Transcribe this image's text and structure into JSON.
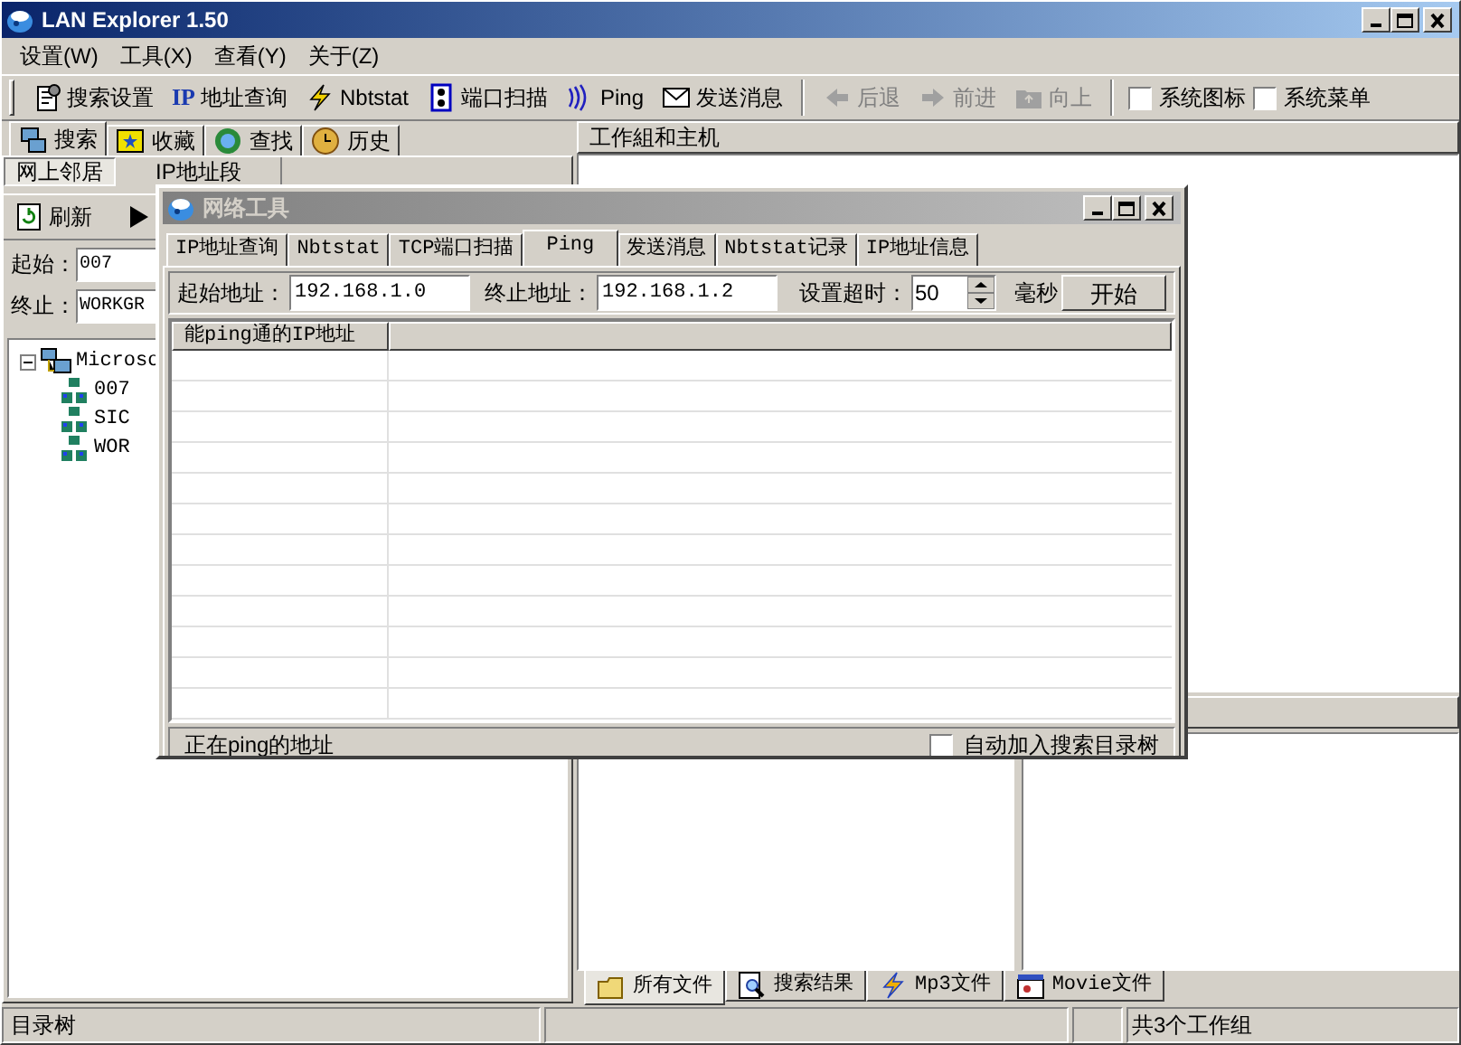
{
  "window": {
    "title": "LAN Explorer 1.50"
  },
  "menu": [
    {
      "label": "设置(W)"
    },
    {
      "label": "工具(X)"
    },
    {
      "label": "查看(Y)"
    },
    {
      "label": "关于(Z)"
    }
  ],
  "toolbar": [
    {
      "kind": "button",
      "label": "搜索设置",
      "disabled": false
    },
    {
      "kind": "button",
      "icon_text": "IP",
      "label": "地址查询",
      "disabled": false
    },
    {
      "kind": "button",
      "label": "Nbtstat",
      "disabled": false
    },
    {
      "kind": "button",
      "label": "端口扫描",
      "disabled": false
    },
    {
      "kind": "button",
      "label": "Ping",
      "disabled": false
    },
    {
      "kind": "button",
      "label": "发送消息",
      "disabled": false
    },
    {
      "kind": "separator"
    },
    {
      "kind": "button",
      "label": "后退",
      "disabled": true
    },
    {
      "kind": "button",
      "label": "前进",
      "disabled": true
    },
    {
      "kind": "button",
      "label": "向上",
      "disabled": true
    },
    {
      "kind": "separator"
    },
    {
      "kind": "checkbox",
      "label": "系统图标",
      "checked": false
    },
    {
      "kind": "checkbox",
      "label": "系统菜单",
      "checked": false
    }
  ],
  "left_panel": {
    "tabs": [
      {
        "label": "搜索",
        "selected": true
      },
      {
        "label": "收藏",
        "selected": false
      },
      {
        "label": "查找",
        "selected": false
      },
      {
        "label": "历史",
        "selected": false
      }
    ],
    "subtabs": [
      {
        "label": "网上邻居",
        "selected": true
      },
      {
        "label": "IP地址段",
        "selected": false
      }
    ],
    "refresh": "刷新",
    "start": {
      "label": "起始：",
      "value": "007"
    },
    "end": {
      "label": "终止：",
      "value": "WORKGR"
    },
    "tree": [
      {
        "label": "Microso",
        "expanded": true,
        "children": [
          {
            "label": "007"
          },
          {
            "label": "SIC"
          },
          {
            "label": "WOR"
          }
        ]
      }
    ]
  },
  "right_panel": {
    "header": "工作組和主机",
    "bottom_tabs": [
      {
        "label": "所有文件",
        "selected": true
      },
      {
        "label": "搜索结果",
        "selected": false
      },
      {
        "label": "Mp3文件",
        "selected": false
      },
      {
        "label": "Movie文件",
        "selected": false
      }
    ]
  },
  "status_bar": {
    "left": "目录树",
    "right": "共3个工作组"
  },
  "dialog": {
    "title": "网络工具",
    "tabs": [
      {
        "label": "IP地址查询",
        "selected": false
      },
      {
        "label": "Nbtstat",
        "selected": false
      },
      {
        "label": "TCP端口扫描",
        "selected": false
      },
      {
        "label": "Ping",
        "selected": true
      },
      {
        "label": "发送消息",
        "selected": false
      },
      {
        "label": "Nbtstat记录",
        "selected": false
      },
      {
        "label": "IP地址信息",
        "selected": false
      }
    ],
    "start": {
      "label": "起始地址：",
      "value": "192.168.1.0"
    },
    "end": {
      "label": "终止地址：",
      "value": "192.168.1.2"
    },
    "timeout": {
      "label": "设置超时：",
      "value": "50",
      "unit": "毫秒"
    },
    "start_button": "开始",
    "table": {
      "columns": [
        "能ping通的IP地址"
      ]
    },
    "status": "正在ping的地址",
    "auto_add": {
      "label": "自动加入搜索目录树",
      "checked": false
    }
  }
}
